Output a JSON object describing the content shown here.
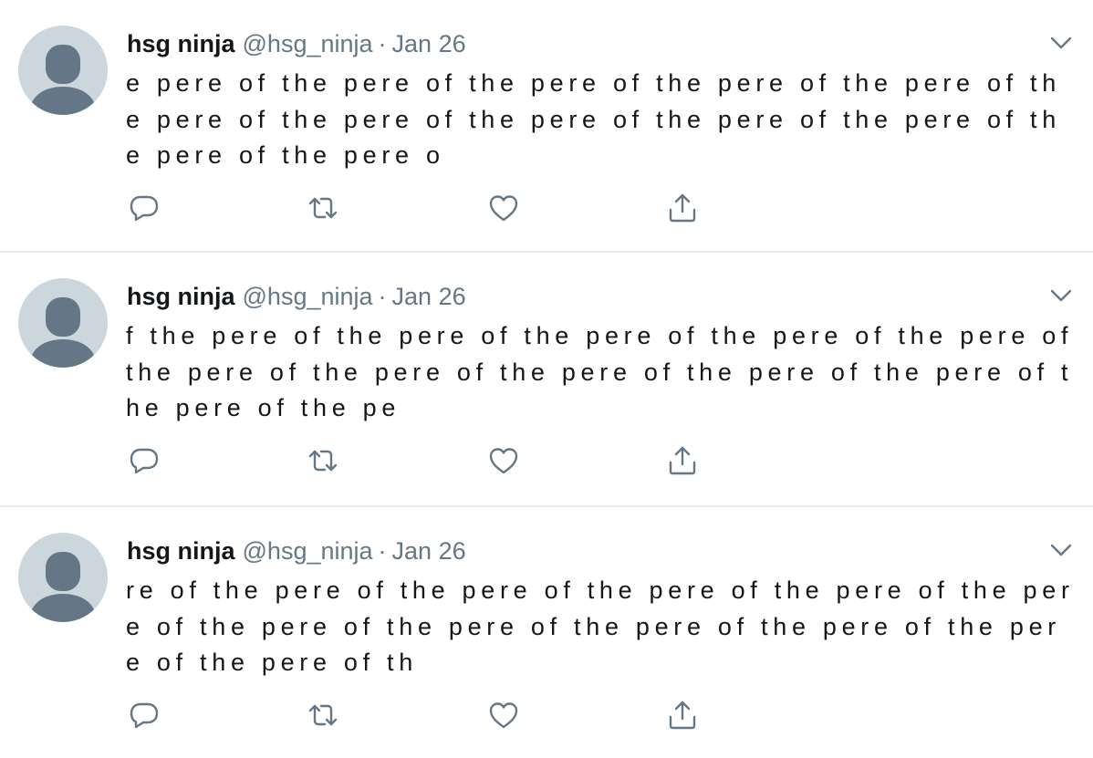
{
  "colors": {
    "name": "#14171a",
    "meta": "#657786",
    "icon": "#657786",
    "divider": "#e6ecf0",
    "avatar_bg": "#ccd6dd",
    "avatar_fg": "#657786"
  },
  "icons": {
    "reply": "reply-icon",
    "retweet": "retweet-icon",
    "like": "like-icon",
    "share": "share-icon",
    "caret": "chevron-down-icon",
    "avatar": "default-avatar-icon"
  },
  "tweets": [
    {
      "display_name": "hsg ninja",
      "handle": "@hsg_ninja",
      "separator": "·",
      "date": "Jan 26",
      "text": "e pere of the pere of the pere of the pere of the pere of the pere of the pere of the pere of the pere of the pere of the pere of the pere o"
    },
    {
      "display_name": "hsg ninja",
      "handle": "@hsg_ninja",
      "separator": "·",
      "date": "Jan 26",
      "text": "f the pere of the pere of the pere of the pere of the pere of the pere of the pere of the pere of the pere of the pere of the pere of the pe"
    },
    {
      "display_name": "hsg ninja",
      "handle": "@hsg_ninja",
      "separator": "·",
      "date": "Jan 26",
      "text": "re of the pere of the pere of the pere of the pere of the pere of the pere of the pere of the pere of the pere of the pere of the pere of th"
    }
  ]
}
